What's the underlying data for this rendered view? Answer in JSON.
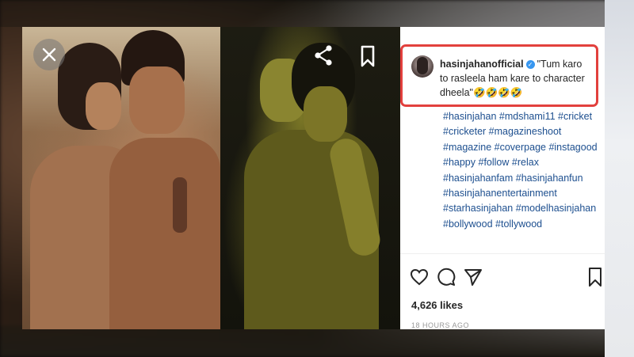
{
  "viewer": {
    "close_icon": "close-icon",
    "share_icon": "share-icon",
    "bookmark_icon": "bookmark-icon"
  },
  "post": {
    "username": "hasinjahanofficial",
    "verified_icon": "verified-badge-icon",
    "caption_line": "\"Tum karo to rasleela ham kare to character dheela\"🤣🤣🤣🤣",
    "hashtags": [
      "#hasinjahan",
      "#mdshami11",
      "#cricket",
      "#cricketer",
      "#magazineshoot",
      "#magazine",
      "#coverpage",
      "#instagood",
      "#happy",
      "#follow",
      "#relax",
      "#hasinjahanfam",
      "#hasinjahanfun",
      "#hasinjahanentertainment",
      "#starhasinjahan",
      "#modelhasinjahan",
      "#bollywood",
      "#tollywood"
    ],
    "likes": "4,626 likes",
    "timestamp": "18 HOURS AGO"
  },
  "actions": {
    "like_icon": "heart-icon",
    "comment_icon": "comment-icon",
    "share_icon": "send-icon",
    "save_icon": "bookmark-icon"
  },
  "colors": {
    "highlight_border": "#e2403d",
    "hashtag_link": "#1d4f8f",
    "verified": "#3897f0"
  }
}
